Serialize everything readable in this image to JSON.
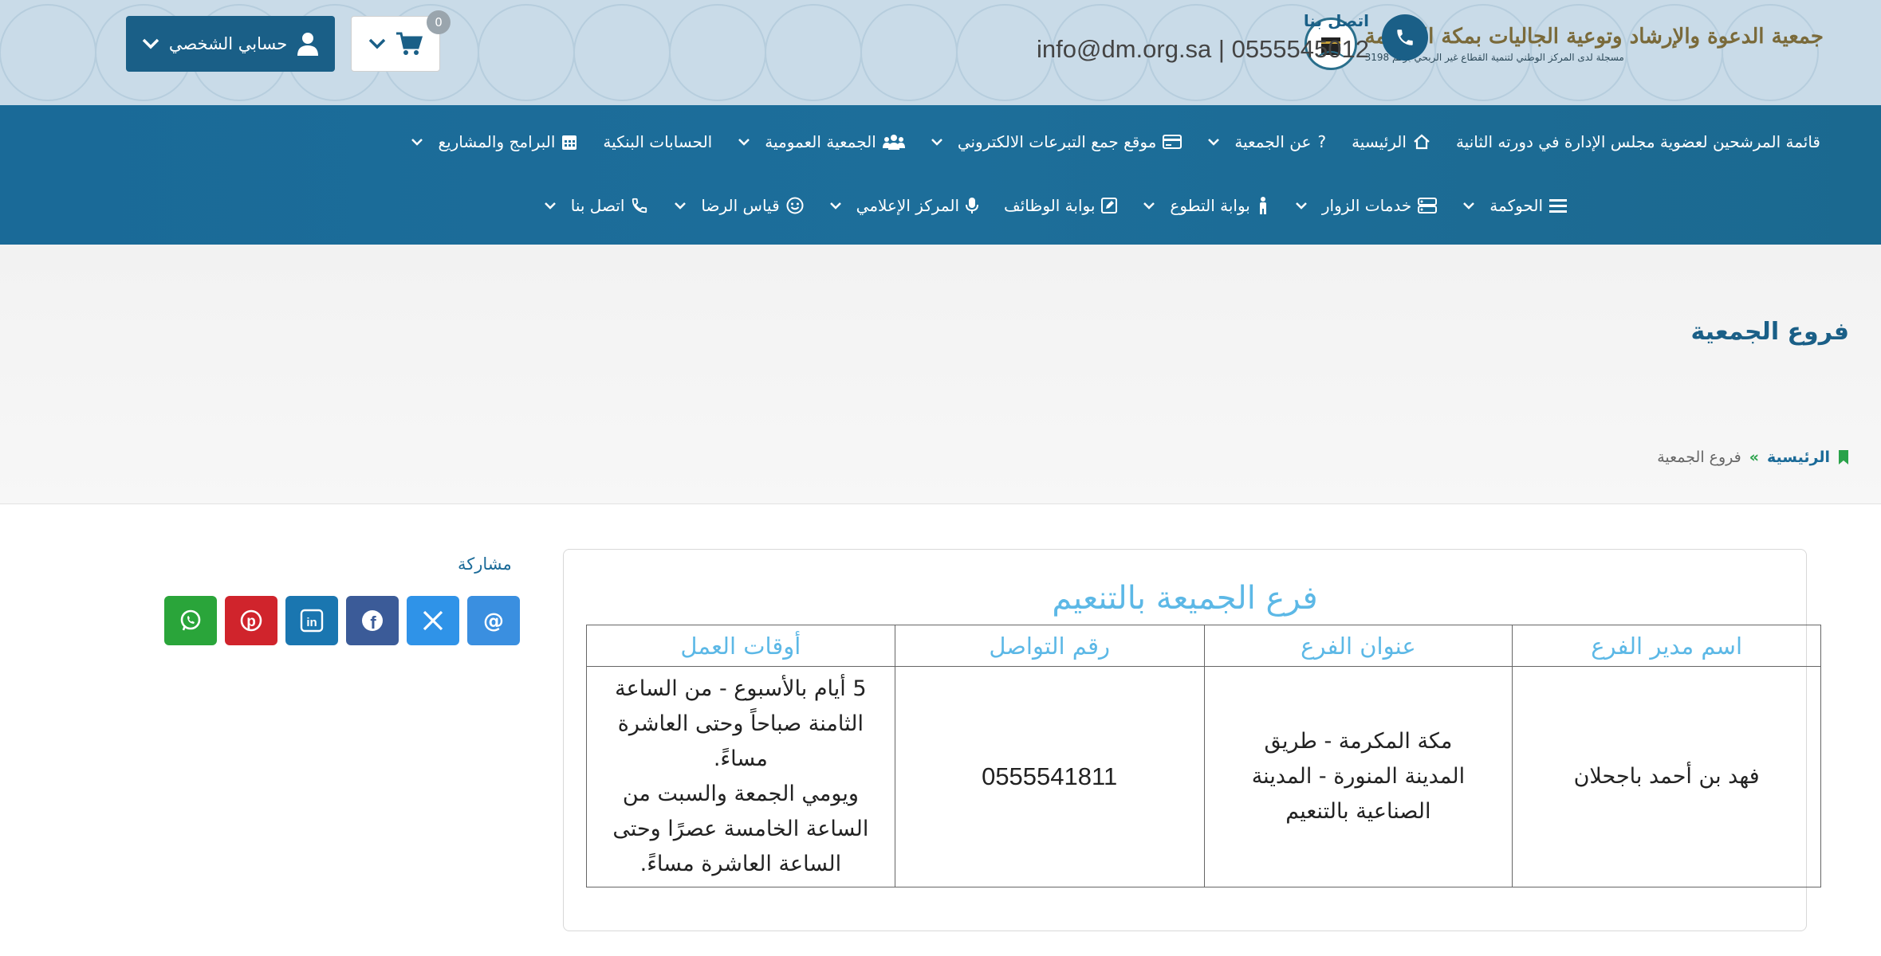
{
  "header": {
    "logo_main": "جمعية الدعوة والإرشاد وتوعية الجاليات بمكة المكرمة",
    "logo_sub": "مسجلة لدى المركز الوطني لتنمية القطاع غير الربحي برقم 3198",
    "contact_label": "اتصل بنا",
    "contact_info": "info@dm.org.sa | 0555545012",
    "cart_count": "0",
    "account_label": "حسابي الشخصي"
  },
  "nav": {
    "row1": [
      {
        "label": "قائمة المرشحين لعضوية مجلس الإدارة في دورته الثانية",
        "icon": "none",
        "dropdown": false
      },
      {
        "label": "الرئيسية",
        "icon": "home-icon",
        "dropdown": false
      },
      {
        "label": "عن الجمعية",
        "icon": "question-icon",
        "dropdown": true
      },
      {
        "label": "موقع جمع التبرعات الالكتروني",
        "icon": "credit-card-icon",
        "dropdown": true
      },
      {
        "label": "الجمعية العمومية",
        "icon": "users-icon",
        "dropdown": true
      },
      {
        "label": "الحسابات البنكية",
        "icon": "none",
        "dropdown": false
      },
      {
        "label": "البرامج والمشاريع",
        "icon": "calendar-icon",
        "dropdown": true
      }
    ],
    "row2": [
      {
        "label": "الحوكمة",
        "icon": "bars-icon",
        "dropdown": true
      },
      {
        "label": "خدمات الزوار",
        "icon": "server-icon",
        "dropdown": true
      },
      {
        "label": "بوابة التطوع",
        "icon": "child-icon",
        "dropdown": true
      },
      {
        "label": "بوابة الوظائف",
        "icon": "edit-icon",
        "dropdown": false
      },
      {
        "label": "المركز الإعلامي",
        "icon": "microphone-icon",
        "dropdown": true
      },
      {
        "label": "قياس الرضا",
        "icon": "smile-icon",
        "dropdown": true
      },
      {
        "label": "اتصل بنا",
        "icon": "phone-icon",
        "dropdown": true
      }
    ]
  },
  "page": {
    "title": "فروع الجمعية",
    "breadcrumb_home": "الرئيسية",
    "breadcrumb_sep": "»",
    "breadcrumb_current": "فروع الجمعية"
  },
  "share": {
    "label": "مشاركة",
    "buttons": [
      {
        "name": "email",
        "color": "#3a8fe0"
      },
      {
        "name": "x",
        "color": "#2f93e8"
      },
      {
        "name": "facebook",
        "color": "#3b5b98"
      },
      {
        "name": "linkedin",
        "color": "#1a76b0"
      },
      {
        "name": "pinterest",
        "color": "#d0242c"
      },
      {
        "name": "whatsapp",
        "color": "#2aa53a"
      }
    ]
  },
  "branch": {
    "title": "فرع الجميعة بالتنعيم",
    "columns": [
      "اسم مدير الفرع",
      "عنوان الفرع",
      "رقم التواصل",
      "أوقات العمل"
    ],
    "row": {
      "manager": "فهد بن أحمد باجحلان",
      "address": "مكة المكرمة - طريق المدينة المنورة - المدينة الصناعية بالتنعيم",
      "phone": "0555541811",
      "hours_1": "5 أيام بالأسبوع - من الساعة الثامنة صباحاً وحتى العاشرة مساءً.",
      "hours_2": "ويومي الجمعة والسبت من الساعة الخامسة عصرًا وحتى الساعة العاشرة مساءً."
    }
  },
  "colors": {
    "primary": "#1a5f87",
    "nav_bg": "#1d6e9a",
    "accent_light_blue": "#5cb8e6",
    "breadcrumb_sep_green": "#2aa24a"
  }
}
